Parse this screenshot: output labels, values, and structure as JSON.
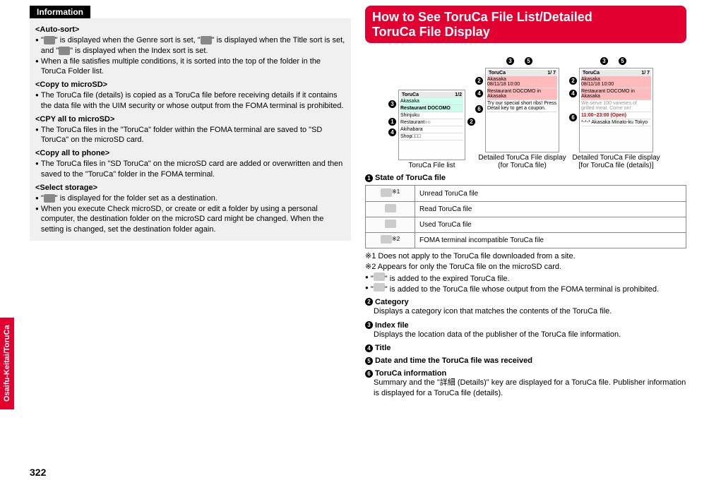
{
  "side_tab": "Osaifu-Keitai/ToruCa",
  "page_number": "322",
  "left": {
    "info_header": "Information",
    "auto_sort": {
      "title": "<Auto-sort>",
      "b1_pre": "\"",
      "b1_mid1": "\" is displayed when the Genre sort is set, \"",
      "b1_mid2": "\" is displayed when the Title sort is set, and \"",
      "b1_post": "\" is displayed when the Index sort is set.",
      "b2": "When a file satisfies multiple conditions, it is sorted into the top of the folder in the ToruCa Folder list."
    },
    "copy_microsd": {
      "title": "<Copy to microSD>",
      "b1": "The ToruCa file (details) is copied as a ToruCa file before receiving details if it contains the data file with the UIM security or whose output from the FOMA terminal is prohibited."
    },
    "cpy_all_microsd": {
      "title": "<CPY all to microSD>",
      "b1": "The ToruCa files in the \"ToruCa\" folder within the FOMA terminal are saved to \"SD ToruCa\" on the microSD card."
    },
    "copy_all_phone": {
      "title": "<Copy all to phone>",
      "b1": "The ToruCa files in \"SD ToruCa\" on the microSD card are added or overwritten and then saved to the \"ToruCa\" folder in the FOMA terminal."
    },
    "select_storage": {
      "title": "<Select storage>",
      "b1_pre": "\"",
      "b1_post": "\" is displayed for the folder set as a destination.",
      "b2": "When you execute Check microSD, or create or edit a folder by using a personal computer, the destination folder on the microSD card might be changed. When the setting is changed, set the destination folder again."
    }
  },
  "right": {
    "banner_l1": "How to See ToruCa File List/Detailed",
    "banner_l2": "ToruCa File Display",
    "fig_captions": {
      "a": "ToruCa File list",
      "b_l1": "Detailed ToruCa File display",
      "b_l2": "(for ToruCa file)",
      "c_l1": "Detailed ToruCa File display",
      "c_l2": "[for ToruCa file (details)]"
    },
    "screen_list": {
      "header_left": "ToruCa",
      "header_right": "1/2",
      "rows": [
        "Akasaka",
        "Restaurant DOCOMO",
        "Shinjuku",
        "Restaurant○○",
        "Akihabara",
        "Shop□□□"
      ]
    },
    "screen_detail1": {
      "header_left": "ToruCa",
      "header_right": "1/ 7",
      "row1": "Akasaka",
      "row1b": "08/11/18 10:00",
      "row2": "Restaurant DOCOMO in Akasaka",
      "row3": "Try our special short ribs! Press Detail key to get a coupon."
    },
    "screen_detail2": {
      "header_left": "ToruCa",
      "header_right": "1/ 7",
      "row1": "Akasaka",
      "row1b": "08/11/18 10:00",
      "row2": "Restaurant DOCOMO in Akasaka",
      "row3": "We serve 100 varieties of grilled meat. Come on!",
      "row4": "11:00~23:00 (Open)",
      "row5": "*-*-* Akasaka Minato-ku Tokyo"
    },
    "item1_title": "State of ToruCa file",
    "table": {
      "note1_mark": "※1",
      "note2_mark": "※2",
      "r1": "Unread ToruCa file",
      "r2": "Read ToruCa file",
      "r3": "Used ToruCa file",
      "r4": "FOMA terminal incompatible ToruCa file"
    },
    "notes": {
      "n1": "※1 Does not apply to the ToruCa file downloaded from a site.",
      "n2": "※2 Appears for only the ToruCa file on the microSD card.",
      "b1_pre": "\"",
      "b1_post": "\" is added to the expired ToruCa file.",
      "b2_pre": "\"",
      "b2_post": "\" is added to the ToruCa file whose output from the FOMA terminal is prohibited."
    },
    "item2_title": "Category",
    "item2_desc": "Displays a category icon that matches the contents of the ToruCa file.",
    "item3_title": "Index file",
    "item3_desc": "Displays the location data of the publisher of the ToruCa file information.",
    "item4_title": "Title",
    "item5_title": "Date and time the ToruCa file was received",
    "item6_title": "ToruCa information",
    "item6_desc": "Summary and the \"詳細 (Details)\" key are displayed for a ToruCa file. Publisher information is displayed for a ToruCa file (details)."
  }
}
